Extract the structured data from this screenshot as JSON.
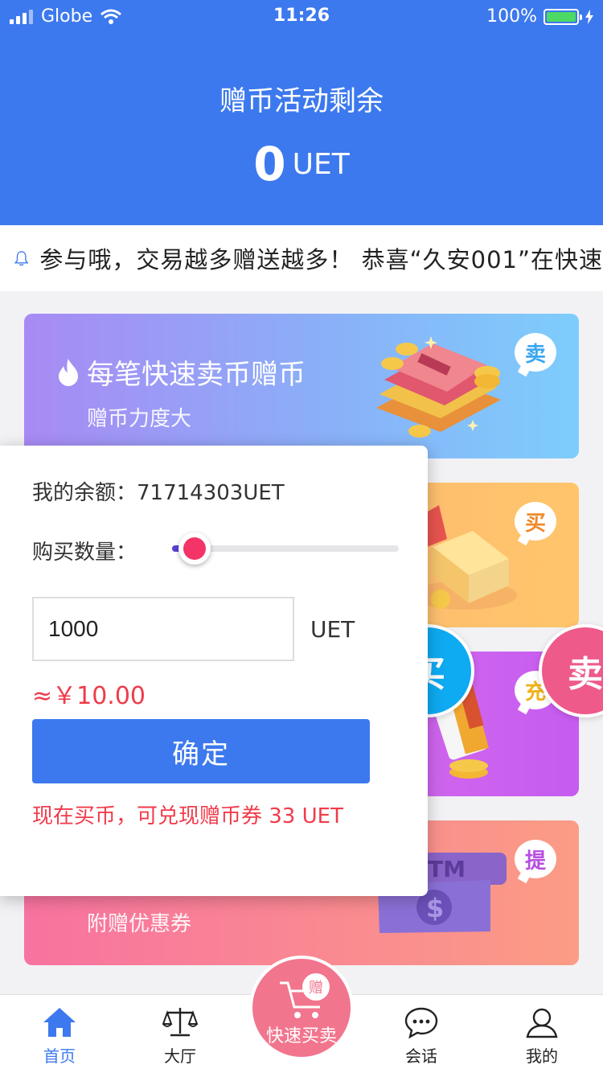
{
  "status_bar": {
    "carrier": "Globe",
    "time": "11:26",
    "battery": "100%"
  },
  "header": {
    "title": "赠币活动剩余",
    "amount": "0",
    "unit": "UET"
  },
  "notice": {
    "icon": "bell-icon",
    "text": "参与哦，交易越多赠送越多！   恭喜“久安001”在快速"
  },
  "cards": [
    {
      "title": "每笔快速卖币赠币",
      "subtitle": "赠币力度大",
      "tag": "卖",
      "icon": "flame-icon"
    },
    {
      "title": "",
      "subtitle": "",
      "tag": "买"
    },
    {
      "title": "",
      "subtitle": "",
      "tag": "充"
    },
    {
      "title": "",
      "subtitle": "附赠优惠券",
      "tag": "提"
    }
  ],
  "panel": {
    "balance_label": "我的余额：71714303UET",
    "quantity_label": "购买数量：",
    "slider_fraction": 0.1,
    "amount_value": "1000",
    "amount_unit": "UET",
    "approx_price": "≈￥10.00",
    "confirm_label": "确定",
    "promo_text": "现在买币，可兑现赠币券 33 UET"
  },
  "float_buttons": {
    "buy": "买",
    "sell": "卖"
  },
  "tabbar": {
    "items": [
      {
        "label": "首页",
        "icon": "home-icon",
        "active": true
      },
      {
        "label": "大厅",
        "icon": "scale-icon",
        "active": false
      },
      {
        "label": "会话",
        "icon": "chat-icon",
        "active": false
      },
      {
        "label": "我的",
        "icon": "user-icon",
        "active": false
      }
    ],
    "center": {
      "label": "快速买卖",
      "badge": "赠",
      "icon": "cart-icon"
    }
  },
  "colors": {
    "brand_blue": "#3d79ee",
    "price_red": "#f03b4a",
    "slider_thumb": "#f43366",
    "buy_float": "#0eaaf2",
    "sell_float": "#ee5a8a"
  }
}
